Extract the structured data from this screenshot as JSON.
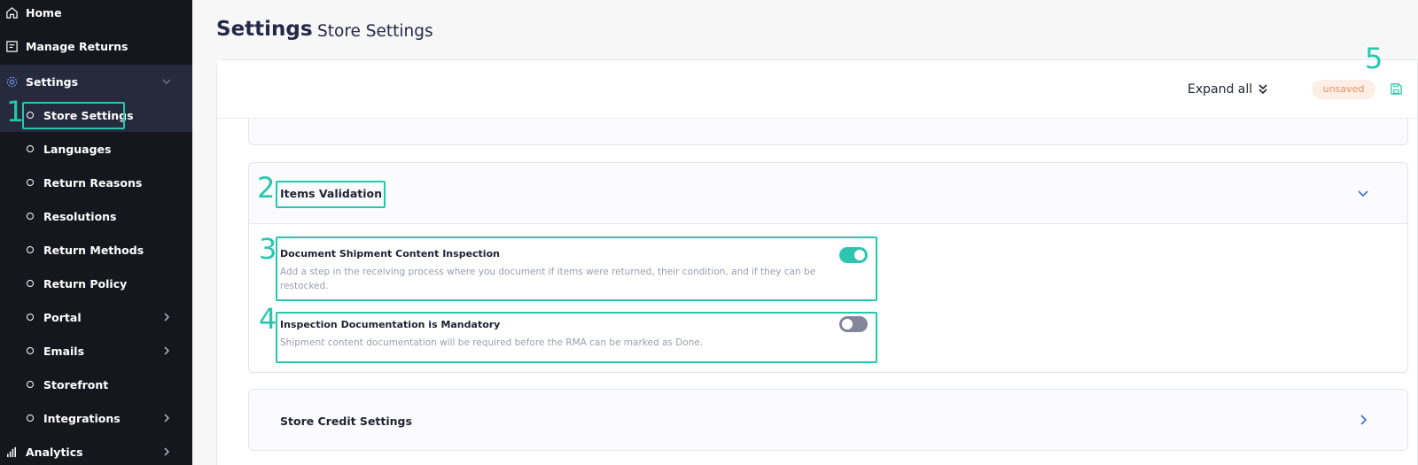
{
  "sidebar": {
    "items": [
      {
        "label": "Home",
        "icon": "home-icon"
      },
      {
        "label": "Manage Returns",
        "icon": "returns-icon"
      },
      {
        "label": "Settings",
        "icon": "gear-icon"
      },
      {
        "label": "Store Settings"
      },
      {
        "label": "Languages"
      },
      {
        "label": "Return Reasons"
      },
      {
        "label": "Resolutions"
      },
      {
        "label": "Return Methods"
      },
      {
        "label": "Return Policy"
      },
      {
        "label": "Portal"
      },
      {
        "label": "Emails"
      },
      {
        "label": "Storefront"
      },
      {
        "label": "Integrations"
      },
      {
        "label": "Analytics",
        "icon": "analytics-icon"
      }
    ]
  },
  "header": {
    "title": "Settings",
    "separator": "•",
    "subtitle": "Store Settings"
  },
  "toolbar": {
    "expand_all_label": "Expand all",
    "status_badge": "unsaved"
  },
  "sections": {
    "items_validation": {
      "title": "Items Validation",
      "settings": [
        {
          "title": "Document Shipment Content Inspection",
          "description_line1": "Add a step in the receiving process where you document if items were returned, their condition, and if they can be",
          "description_line2": "restocked.",
          "enabled": true
        },
        {
          "title": "Inspection Documentation is Mandatory",
          "description_line1": "Shipment content documentation will be required before the RMA can be marked as Done.",
          "enabled": false
        }
      ]
    },
    "store_credit": {
      "title": "Store Credit Settings"
    }
  },
  "annotations": [
    "1",
    "2",
    "3",
    "4",
    "5"
  ],
  "colors": {
    "sidebar_bg": "#16161f",
    "sidebar_active": "#262a3d",
    "accent": "#2ec4b0",
    "annotation": "#25c7ae",
    "badge_bg": "#fdeee6",
    "badge_text": "#ee8e62",
    "chevron": "#3b6fd8"
  }
}
